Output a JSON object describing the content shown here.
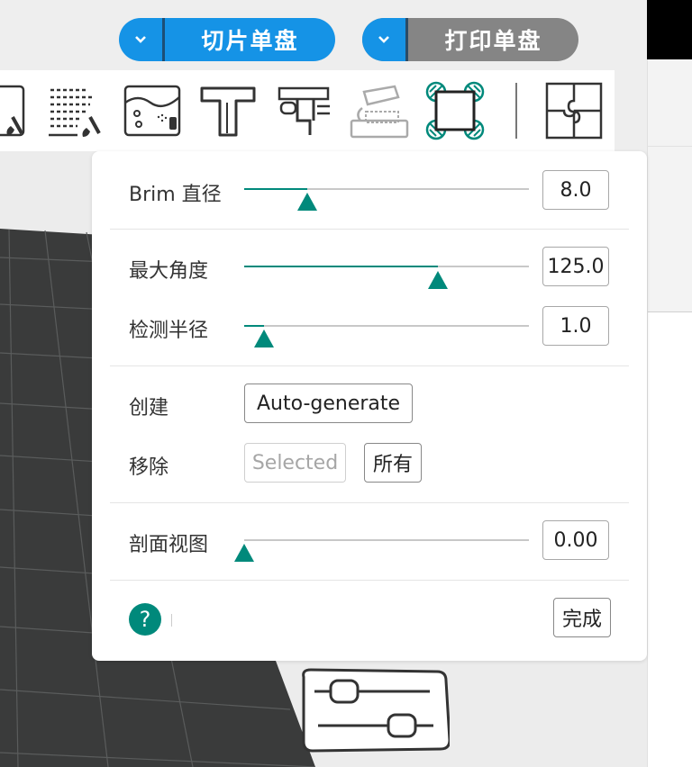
{
  "header": {
    "slice_label": "切片单盘",
    "print_label": "打印单盘",
    "dropdown_icon": "chevron-down-icon"
  },
  "toolbar": {
    "tools": [
      "paint-brush-icon",
      "seam-paint-icon",
      "fuzzy-skin-paint-icon",
      "text-embossing-icon",
      "measure-caliper-icon",
      "place-on-face-icon",
      "brim-ears-icon",
      "assembly-puzzle-icon"
    ]
  },
  "panel": {
    "brim": {
      "label": "Brim 直径",
      "value": "8.0",
      "fraction": 0.22
    },
    "max_angle": {
      "label": "最大角度",
      "value": "125.0",
      "fraction": 0.68
    },
    "detect_radius": {
      "label": "检测半径",
      "value": "1.0",
      "fraction": 0.07
    },
    "create": {
      "label": "创建",
      "auto_generate": "Auto-generate"
    },
    "remove": {
      "label": "移除",
      "selected": "Selected",
      "all": "所有"
    },
    "section_view": {
      "label": "剖面视图",
      "value": "0.00",
      "fraction": 0.0
    },
    "help_icon": "question-mark-icon",
    "help_glyph": "?",
    "done": "完成"
  },
  "colors": {
    "accent": "#00897b",
    "primary_blue": "#1593e6",
    "disabled_grey": "#858585",
    "plate": "#3a3b3b"
  }
}
